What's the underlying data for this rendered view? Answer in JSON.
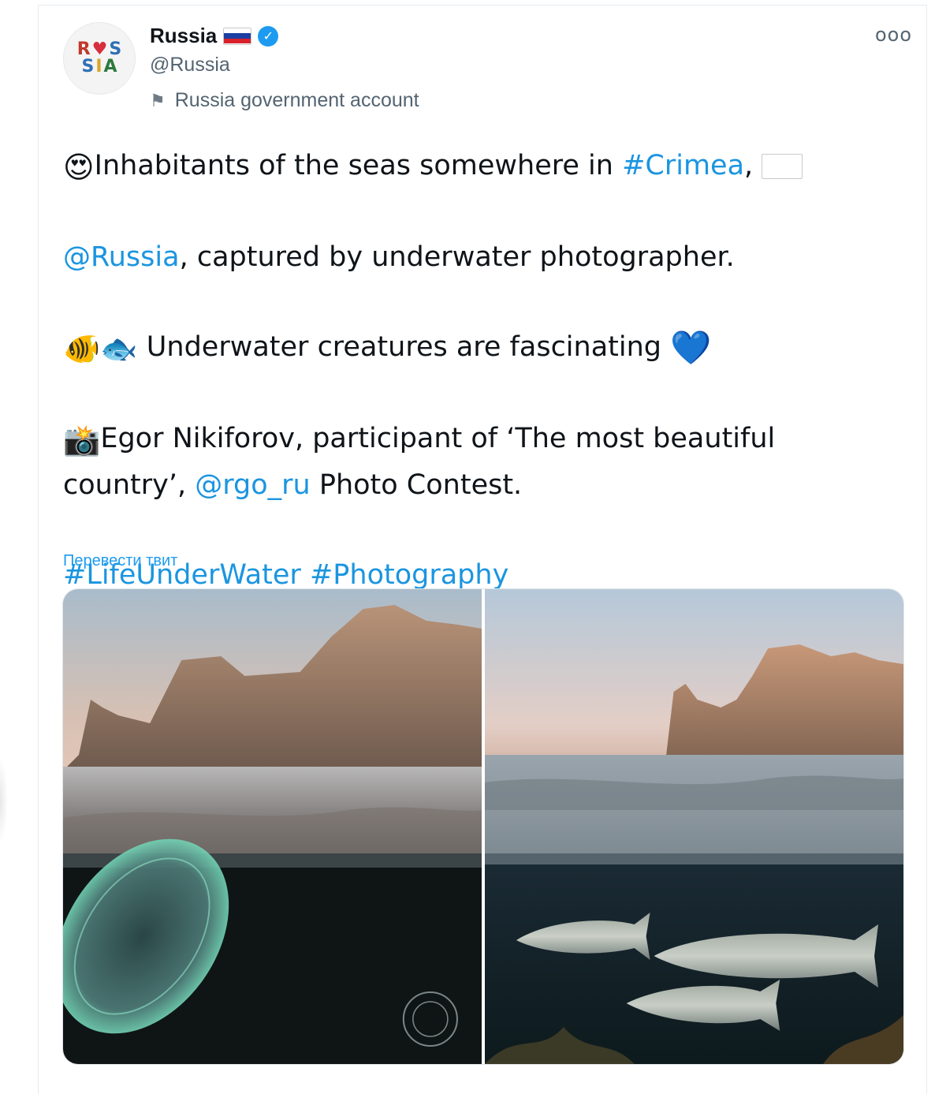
{
  "author": {
    "display_name": "Russia",
    "handle": "@Russia",
    "label": "Russia government account",
    "avatar_text_line1": "R♥S",
    "avatar_text_line2": "SIA"
  },
  "tweet": {
    "line1_pre": "Inhabitants of the seas somewhere in ",
    "hashtag_crimea": "#Crimea",
    "line1_post": ", ",
    "mention_russia": "@Russia",
    "line2_post": ", captured by underwater photographer.",
    "para2": " Underwater creatures are fascinating ",
    "para3_pre": "Egor Nikiforov, participant of ‘The most beautiful country’, ",
    "mention_rgo": "@rgo_ru",
    "para3_post": " Photo Contest.",
    "hashtag_life": "#LifeUnderWater",
    "hashtag_photo": "#Photography",
    "emoji_hearteyes": "😍",
    "emoji_tropical_fish": "🐠",
    "emoji_fish": "🐟",
    "emoji_heart": "💙",
    "emoji_camera": "📸"
  },
  "translate_link": "Перевести твит",
  "more_icon": "ooo",
  "icons": {
    "verified": "verified-badge-icon",
    "gov": "flag-icon",
    "more": "more-options-icon"
  },
  "colors": {
    "link": "#1b95e0",
    "verified": "#1d9bf0",
    "secondary_text": "#536471"
  },
  "media": {
    "photo_count": 2
  }
}
